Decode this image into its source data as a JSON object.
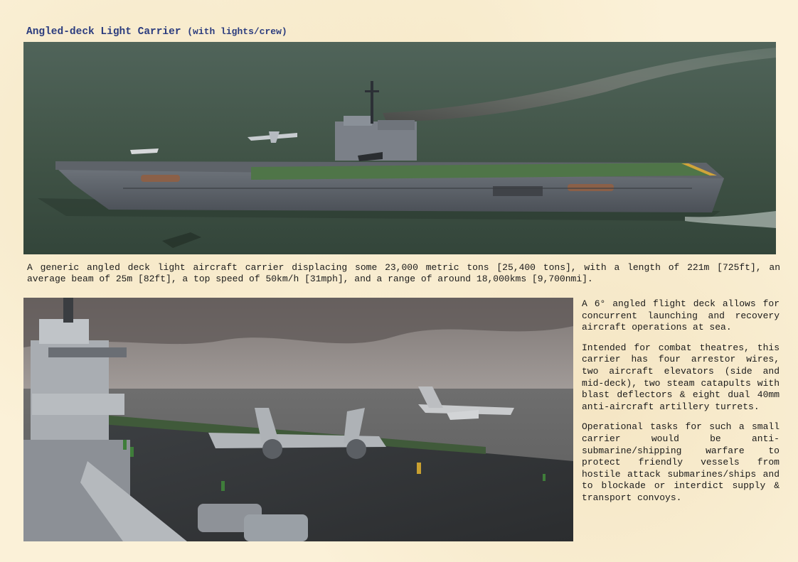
{
  "title": {
    "main": "Angled-deck Light Carrier",
    "sub": "(with lights/crew)"
  },
  "photos": {
    "top": "carrier-underway-photo",
    "bottom": "carrier-deck-photo"
  },
  "caption": "A generic angled deck light aircraft carrier displacing some 23,000 metric tons [25,400 tons], with a length of 221m [725ft], an average beam of 25m [82ft], a top speed of 50km/h [31mph], and a range of around 18,000kms [9,700nmi].",
  "side_paragraphs": [
    "A 6° angled flight deck allows for concurrent launching and recovery aircraft operations at sea.",
    "Intended for combat theatres, this carrier has four arrestor wires, two aircraft elevators (side and mid-deck), two steam catapults with blast deflectors & eight dual 40mm anti-aircraft artillery turrets.",
    "Operational tasks for such a small carrier would be anti-submarine/shipping warfare to protect friendly vessels from hostile attack submarines/ships and to blockade or interdict supply & transport convoys."
  ],
  "colors": {
    "title": "#2b3c7e",
    "background": "#fbf1d8"
  }
}
